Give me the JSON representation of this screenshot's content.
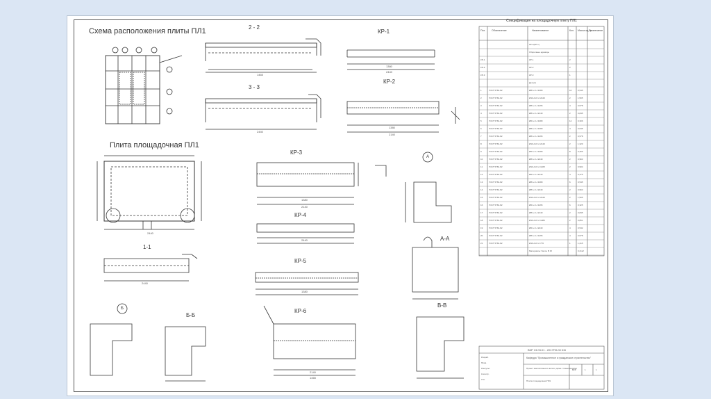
{
  "drawing": {
    "titles": {
      "layout_scheme": "Схема расположения плиты ПЛ1",
      "slab_plan": "Плита площадочная ПЛ1",
      "section_1_1": "1-1",
      "section_2_2": "2 - 2",
      "section_3_3": "3 - 3",
      "kp1": "КР-1",
      "kp2": "КР-2",
      "kp3": "КР-3",
      "kp4": "КР-4",
      "kp5": "КР-5",
      "kp6": "КР-6",
      "node_a": "А",
      "section_a_a": "А-А",
      "node_b": "Б",
      "section_b_b": "Б-Б",
      "section_v_v": "В-В"
    },
    "dims": {
      "d1": "2440",
      "d2": "1465",
      "d3": "2440",
      "d4": "1380",
      "d5": "2440",
      "d6": "1380",
      "d7": "2140",
      "d8": "1380",
      "d9": "2140",
      "d10": "2440",
      "d11": "1380",
      "d12": "2140",
      "d13": "1465",
      "d14": "2440"
    },
    "spec": {
      "caption": "Спецификация на площадочную плиту ПЛ1",
      "headers": [
        "Поз.",
        "Обозначение",
        "Наименование",
        "Кол.",
        "Масса ед. кг",
        "Примечание"
      ],
      "rows": [
        [
          "",
          "",
          "КР-1(КР-1)",
          "",
          "",
          ""
        ],
        [
          "",
          "",
          "Сборочные единицы",
          "",
          "",
          ""
        ],
        [
          "КР-1",
          "",
          "КР-1",
          "2",
          "",
          ""
        ],
        [
          "КР-2",
          "",
          "КР-2",
          "2",
          "",
          ""
        ],
        [
          "КР-3",
          "",
          "КР-3",
          "1",
          "",
          ""
        ],
        [
          "",
          "",
          "Детали",
          "",
          "",
          ""
        ],
        [
          "1",
          "ГОСТ 5781-82",
          "Ø8 A-I L=1380",
          "10",
          "0,545",
          ""
        ],
        [
          "2",
          "ГОСТ 5781-82",
          "Ø10 A-III L=2440",
          "2",
          "1,505",
          ""
        ],
        [
          "3",
          "ГОСТ 5781-82",
          "Ø8 A-I L=1465",
          "4",
          "0,578",
          ""
        ],
        [
          "4",
          "ГОСТ 5781-82",
          "Ø8 A-I L=2140",
          "2",
          "0,845",
          ""
        ],
        [
          "5",
          "ГОСТ 5781-82",
          "Ø6 A-I L=1380",
          "14",
          "0,306",
          ""
        ],
        [
          "6",
          "ГОСТ 5781-82",
          "Ø8 A-I L=1380",
          "4",
          "0,545",
          ""
        ],
        [
          "7",
          "ГОСТ 5781-82",
          "Ø8 A-I L=1465",
          "2",
          "0,578",
          ""
        ],
        [
          "8",
          "ГОСТ 5781-82",
          "Ø10 A-III L=2140",
          "2",
          "1,320",
          ""
        ],
        [
          "9",
          "ГОСТ 5781-82",
          "Ø6 A-I L=1380",
          "8",
          "0,306",
          ""
        ],
        [
          "10",
          "ГОСТ 5781-82",
          "Ø8 A-I L=2440",
          "2",
          "0,963",
          ""
        ],
        [
          "11",
          "ГОСТ 5781-82",
          "Ø10 A-III L=1465",
          "2",
          "0,904",
          ""
        ],
        [
          "12",
          "ГОСТ 5781-82",
          "Ø6 A-I L=2140",
          "4",
          "0,475",
          ""
        ],
        [
          "13",
          "ГОСТ 5781-82",
          "Ø8 A-I L=1380",
          "6",
          "0,545",
          ""
        ],
        [
          "14",
          "ГОСТ 5781-82",
          "Ø8 A-I L=2440",
          "2",
          "0,963",
          ""
        ],
        [
          "15",
          "ГОСТ 5781-82",
          "Ø10 A-III L=2440",
          "2",
          "1,505",
          ""
        ],
        [
          "16",
          "ГОСТ 5781-82",
          "Ø6 A-I L=1465",
          "6",
          "0,325",
          ""
        ],
        [
          "17",
          "ГОСТ 5781-82",
          "Ø8 A-I L=2140",
          "2",
          "0,845",
          ""
        ],
        [
          "18",
          "ГОСТ 5781-82",
          "Ø10 A-III L=1380",
          "2",
          "0,851",
          ""
        ],
        [
          "19",
          "ГОСТ 5781-82",
          "Ø6 A-I L=2440",
          "4",
          "0,542",
          ""
        ],
        [
          "20",
          "ГОСТ 5781-82",
          "Ø8 A-I L=1465",
          "4",
          "0,578",
          ""
        ],
        [
          "21",
          "ГОСТ 5781-82",
          "Ø16 A-III L=770",
          "1",
          "1,215",
          ""
        ],
        [
          "",
          "",
          "Материалы: Бетон В 15",
          "",
          "0,21м³",
          ""
        ]
      ]
    },
    "stamp": {
      "code": "ВКР 13.03.01 - 2017ПЗ-00 КЖ",
      "org": "Кафедра \"Промышленное и гражданское строительство\"",
      "project": "Проект многоэтажного жилого дома с помещениями",
      "sheet_title": "Плита площадочная ПЛ1",
      "stage": "ВКР",
      "sheet": "1",
      "sheets": "1",
      "roles": [
        "Разраб.",
        "Пров.",
        "Консульт.",
        "Н.контр.",
        "Утв."
      ]
    }
  }
}
